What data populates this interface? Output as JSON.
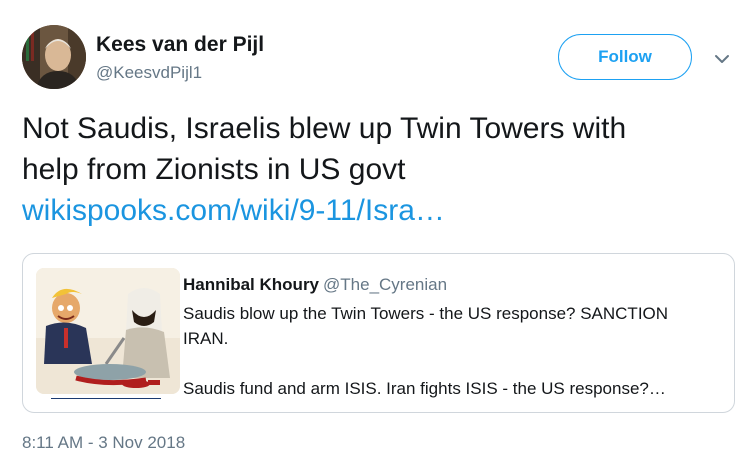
{
  "user": {
    "display_name": "Kees van der Pijl",
    "handle": "@KeesvdPijl1",
    "avatar_icon": "profile-photo"
  },
  "follow_button": {
    "label": "Follow"
  },
  "menu": {
    "icon": "chevron-down-icon"
  },
  "tweet": {
    "text_line_1": "Not Saudis, Israelis blew up Twin Towers  with",
    "text_line_2": "help from Zionists in US govt",
    "link": "wikispooks.com/wiki/9-11/Isra…"
  },
  "quote": {
    "name": "Hannibal Khoury",
    "handle": "@The_Cyrenian",
    "line_1": "Saudis blow up the Twin Towers - the US response? SANCTION",
    "line_2": "IRAN.",
    "line_3": "Saudis fund and arm ISIS. Iran fights ISIS - the US response?…",
    "image_icon": "cartoon-image"
  },
  "timestamp": "8:11 AM - 3 Nov 2018",
  "colors": {
    "accent": "#1da1f2",
    "link": "#1b95e0",
    "secondary_text": "#657786",
    "border": "#d0d6dc"
  }
}
